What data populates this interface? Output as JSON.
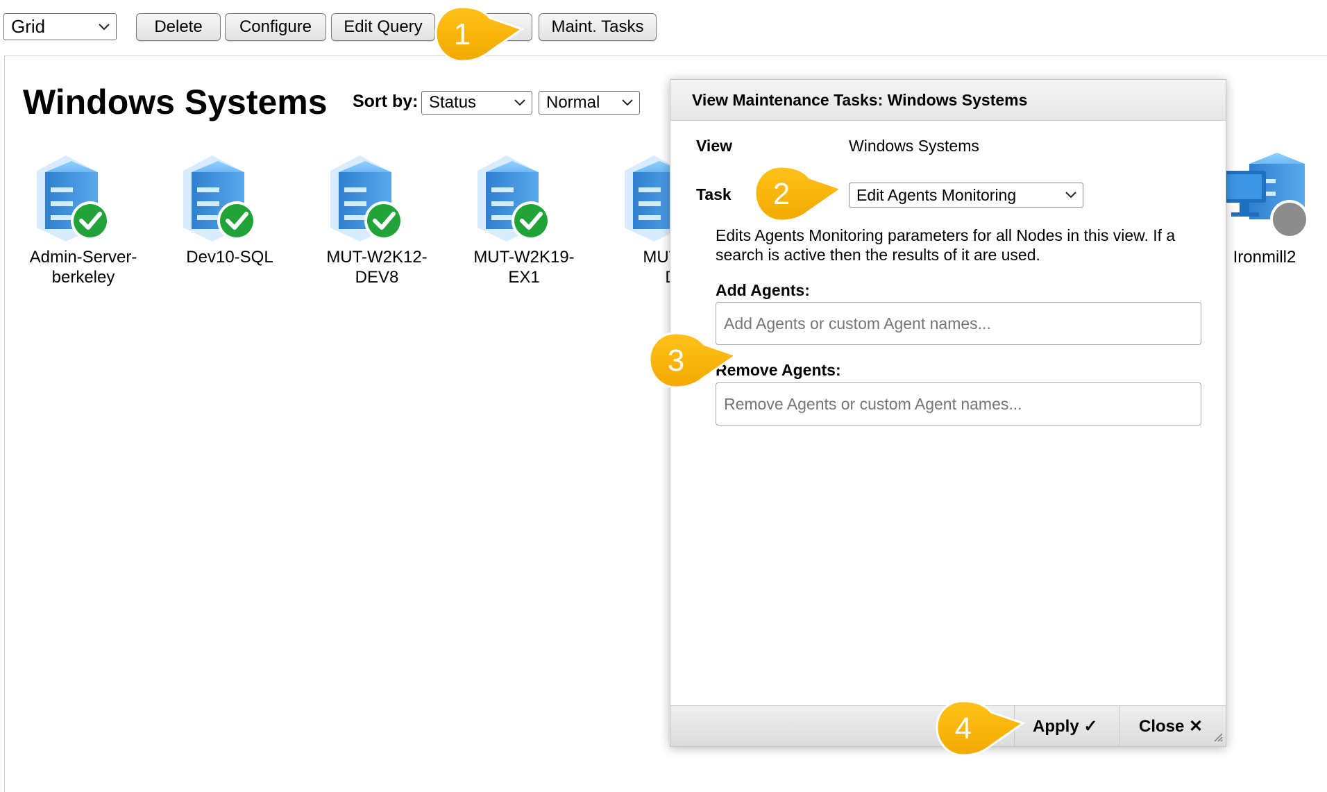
{
  "toolbar": {
    "view_select": "Grid",
    "buttons": [
      "Delete",
      "Configure",
      "Edit Query",
      "",
      "Maint. Tasks"
    ]
  },
  "page": {
    "title": "Windows Systems",
    "sort_label": "Sort by:",
    "sort_value": "Status",
    "size_value": "Normal"
  },
  "nodes": [
    {
      "line1": "Admin-Server-",
      "line2": "berkeley",
      "status": "ok"
    },
    {
      "line1": "Dev10-SQL",
      "line2": "",
      "status": "ok"
    },
    {
      "line1": "MUT-W2K12-",
      "line2": "DEV8",
      "status": "ok"
    },
    {
      "line1": "MUT-W2K19-",
      "line2": "EX1",
      "status": "ok"
    },
    {
      "line1": "MUT-W",
      "line2": "D",
      "status": "ok"
    },
    {
      "line1": "Ironmill2",
      "line2": "",
      "status": "unknown"
    }
  ],
  "dialog": {
    "title": "View Maintenance Tasks: Windows Systems",
    "view_label": "View",
    "view_value": "Windows Systems",
    "task_label": "Task",
    "task_value": "Edit Agents Monitoring",
    "description_line1": "Edits Agents Monitoring parameters for all Nodes in this view. If a",
    "description_line2": "search is active then the results of it are used.",
    "add_label": "Add Agents:",
    "add_placeholder": "Add Agents or custom Agent names...",
    "remove_label": "Remove Agents:",
    "remove_placeholder": "Remove Agents or custom Agent names...",
    "apply_label": "Apply ✓",
    "close_label": "Close ✕"
  },
  "callouts": [
    "1",
    "2",
    "3",
    "4"
  ],
  "colors": {
    "callout": "#f7b500",
    "status_ok": "#22a33a",
    "status_unknown": "#8c8c8c",
    "server_blue": "#3b8fd9"
  }
}
